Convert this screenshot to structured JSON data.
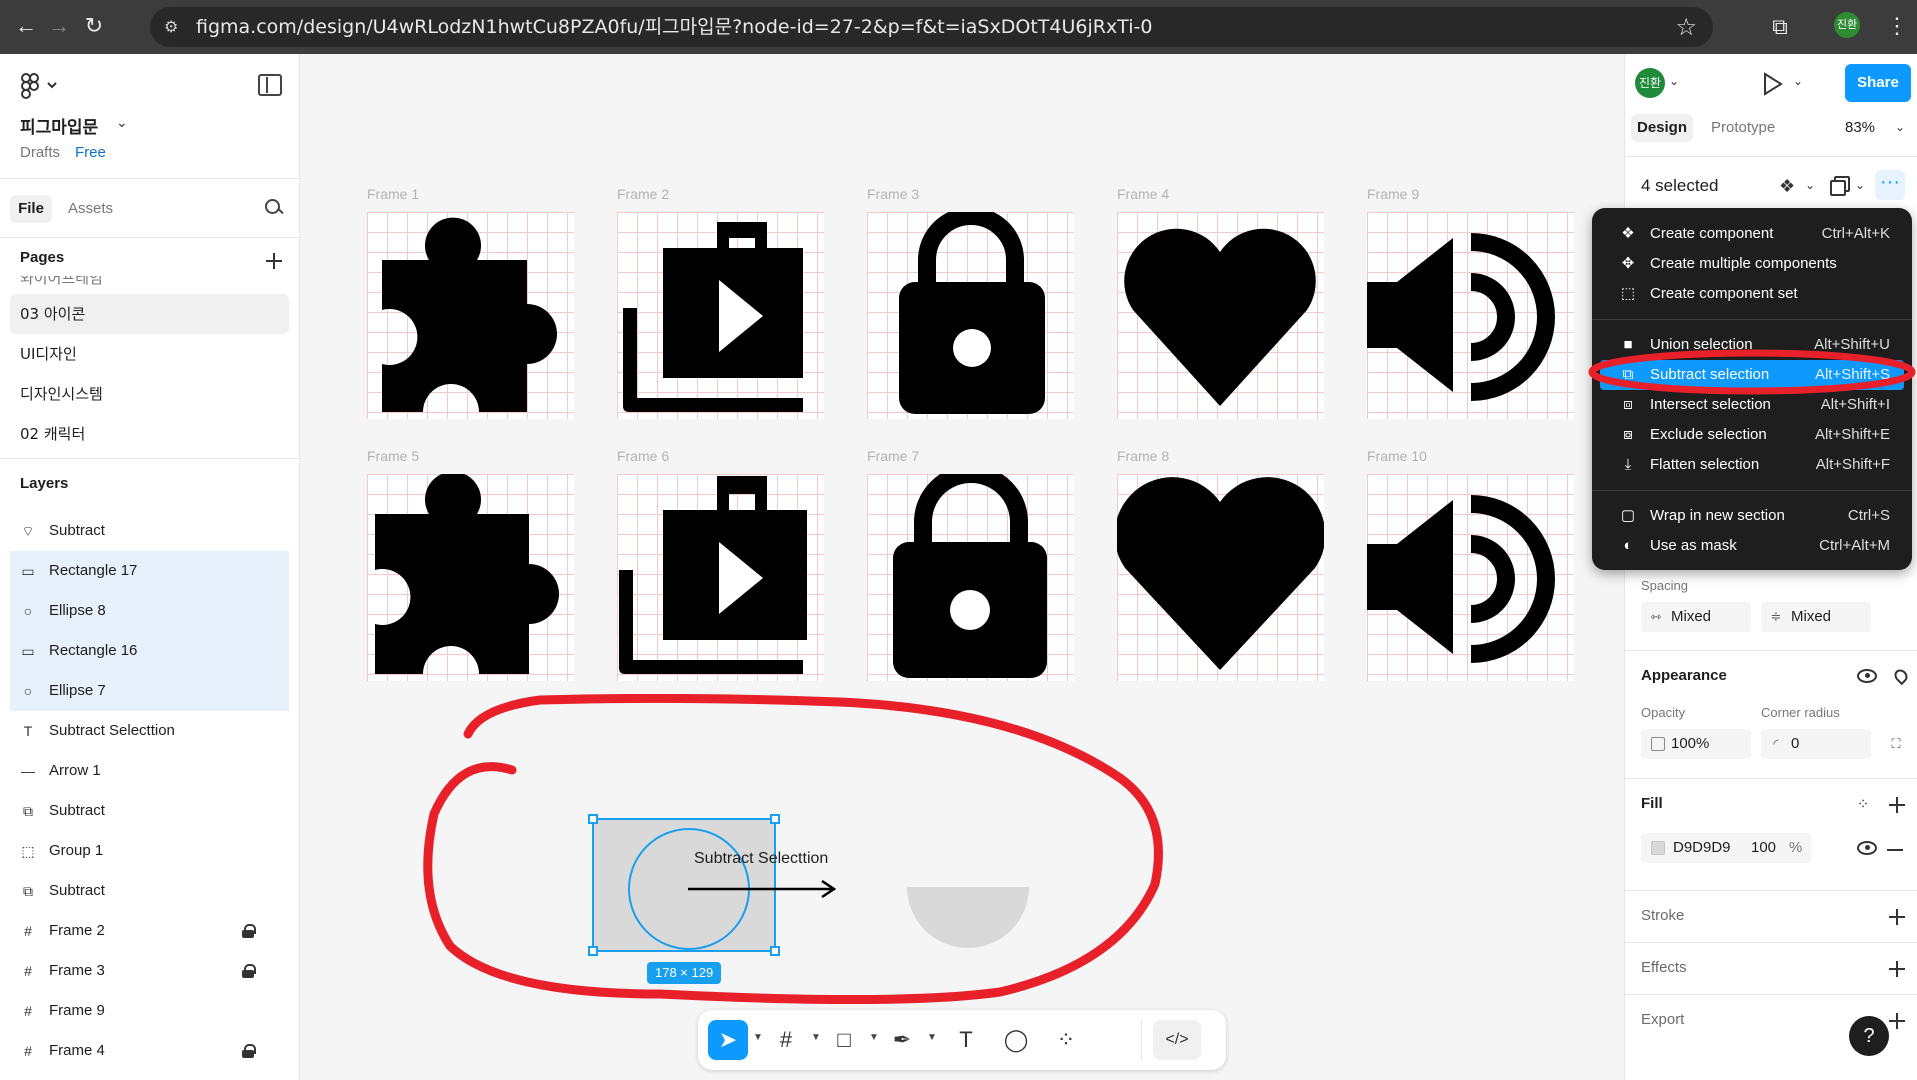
{
  "browser": {
    "url": "figma.com/design/U4wRLodzN1hwtCu8PZA0fu/피그마입문?node-id=27-2&p=f&t=iaSxDOtT4U6jRxTi-0",
    "profile_initials": "진환"
  },
  "left_panel": {
    "file_name": "피그마입문",
    "drafts_label": "Drafts",
    "plan_label": "Free",
    "tabs": [
      "File",
      "Assets"
    ],
    "pages_title": "Pages",
    "pages": [
      "와이어프레임",
      "03 아이콘",
      "UI디자인",
      "디자인시스템",
      "02 캐릭터"
    ],
    "layers_title": "Layers",
    "layers": [
      {
        "name": "Subtract",
        "icon": "subtract-shape-icon",
        "selected": false,
        "locked": false
      },
      {
        "name": "Rectangle 17",
        "icon": "rectangle-icon",
        "selected": true,
        "locked": false
      },
      {
        "name": "Ellipse 8",
        "icon": "ellipse-icon",
        "selected": true,
        "locked": false
      },
      {
        "name": "Rectangle 16",
        "icon": "rectangle-icon",
        "selected": true,
        "locked": false
      },
      {
        "name": "Ellipse 7",
        "icon": "ellipse-icon",
        "selected": true,
        "locked": false
      },
      {
        "name": "Subtract Selecttion",
        "icon": "text-icon",
        "selected": false,
        "locked": false
      },
      {
        "name": "Arrow 1",
        "icon": "arrow-line-icon",
        "selected": false,
        "locked": false
      },
      {
        "name": "Subtract",
        "icon": "boolean-icon",
        "selected": false,
        "locked": false
      },
      {
        "name": "Group 1",
        "icon": "group-icon",
        "selected": false,
        "locked": false
      },
      {
        "name": "Subtract",
        "icon": "boolean-icon",
        "selected": false,
        "locked": false
      },
      {
        "name": "Frame 2",
        "icon": "frame-icon",
        "selected": false,
        "locked": true
      },
      {
        "name": "Frame 3",
        "icon": "frame-icon",
        "selected": false,
        "locked": true
      },
      {
        "name": "Frame 9",
        "icon": "frame-icon",
        "selected": false,
        "locked": false
      },
      {
        "name": "Frame 4",
        "icon": "frame-icon",
        "selected": false,
        "locked": true
      }
    ]
  },
  "canvas": {
    "frames": [
      {
        "label": "Frame 1",
        "icon": "puzzle-icon"
      },
      {
        "label": "Frame 2",
        "icon": "play-bag-icon"
      },
      {
        "label": "Frame 3",
        "icon": "padlock-icon"
      },
      {
        "label": "Frame 4",
        "icon": "heart-icon"
      },
      {
        "label": "Frame 9",
        "icon": "speaker-icon"
      },
      {
        "label": "Frame 5",
        "icon": "puzzle-icon"
      },
      {
        "label": "Frame 6",
        "icon": "play-bag-icon"
      },
      {
        "label": "Frame 7",
        "icon": "padlock-icon"
      },
      {
        "label": "Frame 8",
        "icon": "heart-icon"
      },
      {
        "label": "Frame 10",
        "icon": "speaker-icon"
      }
    ],
    "demo": {
      "label": "Subtract Selecttion",
      "size_badge": "178 × 129",
      "shape_fill": "#d9d9d9",
      "selection_color": "#189ff0",
      "annotation_color": "#e8202a"
    }
  },
  "toolbar": {
    "tools": [
      "move-tool",
      "frame-tool",
      "rectangle-tool",
      "pen-tool",
      "text-tool",
      "comment-tool",
      "actions-tool",
      "dev-mode-tool"
    ]
  },
  "right_panel": {
    "avatar_initials": "진환",
    "share_label": "Share",
    "tabs": [
      "Design",
      "Prototype"
    ],
    "zoom": "83%",
    "selection_count": "4 selected",
    "spacing_label": "Spacing",
    "spacing_values": [
      "Mixed",
      "Mixed"
    ],
    "appearance_title": "Appearance",
    "opacity_label": "Opacity",
    "opacity_value": "100%",
    "corner_radius_label": "Corner radius",
    "corner_radius_value": "0",
    "fill_title": "Fill",
    "fill_hex": "D9D9D9",
    "fill_opacity": "100",
    "fill_unit": "%",
    "stroke_title": "Stroke",
    "effects_title": "Effects",
    "export_title": "Export",
    "help_label": "?"
  },
  "context_menu": {
    "items": [
      {
        "label": "Create component",
        "shortcut": "Ctrl+Alt+K",
        "icon": "component-icon"
      },
      {
        "label": "Create multiple components",
        "shortcut": "",
        "icon": "multi-component-icon"
      },
      {
        "label": "Create component set",
        "shortcut": "",
        "icon": "component-set-icon"
      },
      {
        "label": "Union selection",
        "shortcut": "Alt+Shift+U",
        "icon": "union-icon"
      },
      {
        "label": "Subtract selection",
        "shortcut": "Alt+Shift+S",
        "icon": "subtract-icon"
      },
      {
        "label": "Intersect selection",
        "shortcut": "Alt+Shift+I",
        "icon": "intersect-icon"
      },
      {
        "label": "Exclude selection",
        "shortcut": "Alt+Shift+E",
        "icon": "exclude-icon"
      },
      {
        "label": "Flatten selection",
        "shortcut": "Alt+Shift+F",
        "icon": "flatten-icon"
      },
      {
        "label": "Wrap in new section",
        "shortcut": "Ctrl+S",
        "icon": "section-icon"
      },
      {
        "label": "Use as mask",
        "shortcut": "Ctrl+Alt+M",
        "icon": "mask-icon"
      }
    ],
    "highlighted_item": "Subtract selection",
    "highlight_color": "#0d99ff",
    "annotation_color": "#e8202a"
  }
}
